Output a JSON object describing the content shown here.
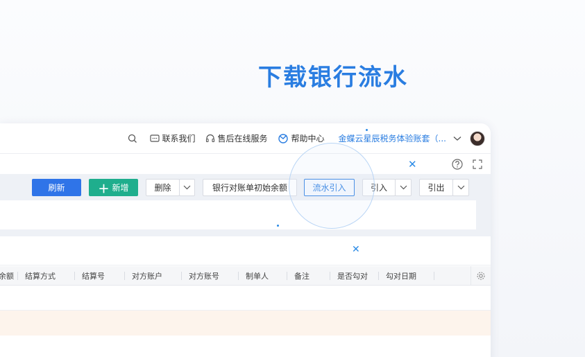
{
  "hero": {
    "title": "下载银行流水"
  },
  "topbar": {
    "contact_label": "联系我们",
    "service_label": "售后在线服务",
    "help_label": "帮助中心",
    "account_label": "金蝶云星辰税务体验账套（..."
  },
  "toolbar": {
    "refresh_label": "刷新",
    "add_label": "新增",
    "delete_label": "删除",
    "bank_init_label": "银行对账单初始余额",
    "import_flow_label": "流水引入",
    "import_label": "引入",
    "export_label": "引出"
  },
  "table": {
    "columns": [
      "余额",
      "结算方式",
      "结算号",
      "对方账户",
      "对方账号",
      "制单人",
      "备注",
      "是否勾对",
      "勾对日期"
    ]
  },
  "colors": {
    "accent": "#2a7de1",
    "primary": "#2f74e8",
    "green": "#1fae8d",
    "row_highlight": "#fdf4ec"
  }
}
